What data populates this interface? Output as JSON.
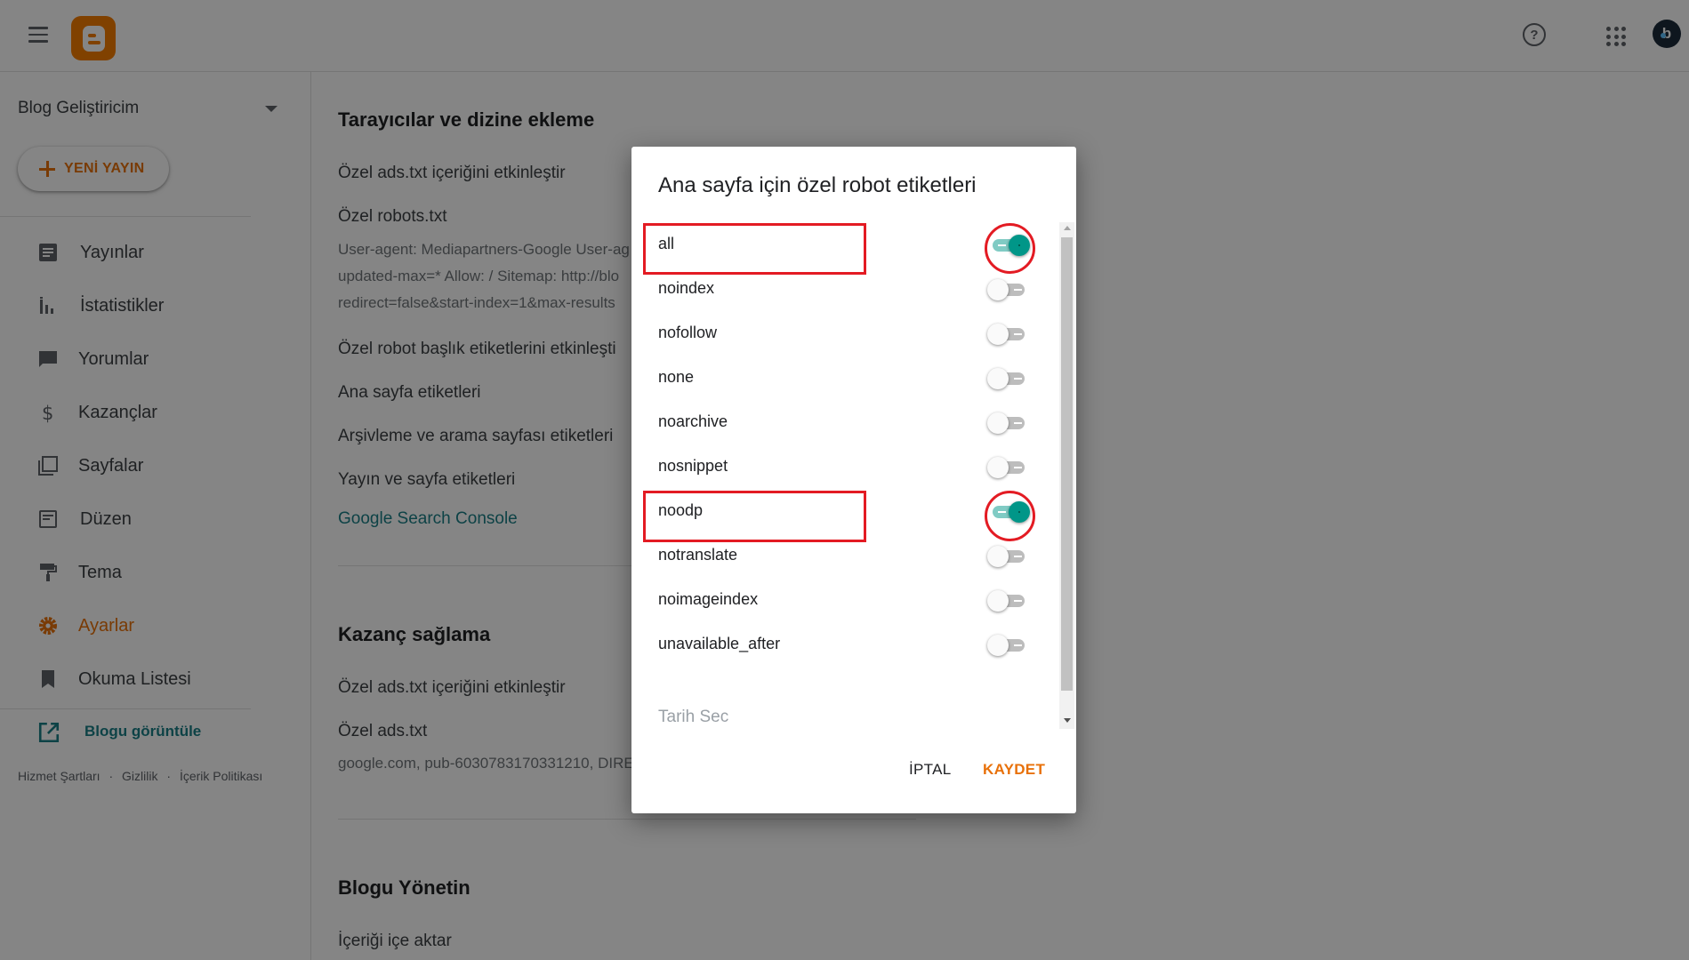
{
  "topbar": {
    "menu_icon": "hamburger-menu-icon",
    "logo_icon": "blogger-logo-icon",
    "help_icon": "help-circle-icon",
    "help_glyph": "?",
    "apps_icon": "apps-grid-icon",
    "avatar_icon": "user-avatar-icon",
    "avatar_letter": "b"
  },
  "sidebar": {
    "blog_name": "Blog Geliştiricim",
    "new_post_label": "YENİ YAYIN",
    "items": [
      {
        "label": "Yayınlar",
        "icon": "posts-icon",
        "active": false
      },
      {
        "label": "İstatistikler",
        "icon": "stats-icon",
        "active": false
      },
      {
        "label": "Yorumlar",
        "icon": "comments-icon",
        "active": false
      },
      {
        "label": "Kazançlar",
        "icon": "earnings-dollar-icon",
        "active": false
      },
      {
        "label": "Sayfalar",
        "icon": "pages-icon",
        "active": false
      },
      {
        "label": "Düzen",
        "icon": "layout-icon",
        "active": false
      },
      {
        "label": "Tema",
        "icon": "theme-paint-roller-icon",
        "active": false
      },
      {
        "label": "Ayarlar",
        "icon": "settings-gear-icon",
        "active": true
      },
      {
        "label": "Okuma Listesi",
        "icon": "bookmark-icon",
        "active": false
      }
    ],
    "view_blog_label": "Blogu görüntüle",
    "footer": {
      "terms": "Hizmet Şartları",
      "privacy": "Gizlilik",
      "content_policy": "İçerik Politikası",
      "separator": "·"
    }
  },
  "main": {
    "section1": {
      "title": "Tarayıcılar ve dizine ekleme",
      "ads_txt_enable": "Özel ads.txt içeriğini etkinleştir",
      "robots_txt_label": "Özel robots.txt",
      "robots_txt_lines": [
        "User-agent: Mediapartners-Google User-ag",
        "updated-max=* Allow: / Sitemap: http://blo",
        "redirect=false&start-index=1&max-results"
      ],
      "robot_header_enable": "Özel robot başlık etiketlerini etkinleşti",
      "home_tags": "Ana sayfa etiketleri",
      "archive_tags": "Arşivleme ve arama sayfası etiketleri",
      "post_tags": "Yayın ve sayfa etiketleri",
      "search_console_link": "Google Search Console"
    },
    "section2": {
      "title": "Kazanç sağlama",
      "ads_txt_enable": "Özel ads.txt içeriğini etkinleştir",
      "ads_txt_label": "Özel ads.txt",
      "ads_txt_value": "google.com, pub-6030783170331210, DIRE"
    },
    "section3": {
      "title": "Blogu Yönetin",
      "import_label": "İçeriği içe aktar"
    }
  },
  "dialog": {
    "title": "Ana sayfa için özel robot etiketleri",
    "options": [
      {
        "label": "all",
        "enabled": true
      },
      {
        "label": "noindex",
        "enabled": false
      },
      {
        "label": "nofollow",
        "enabled": false
      },
      {
        "label": "none",
        "enabled": false
      },
      {
        "label": "noarchive",
        "enabled": false
      },
      {
        "label": "nosnippet",
        "enabled": false
      },
      {
        "label": "noodp",
        "enabled": true
      },
      {
        "label": "notranslate",
        "enabled": false
      },
      {
        "label": "noimageindex",
        "enabled": false
      },
      {
        "label": "unavailable_after",
        "enabled": false
      }
    ],
    "date_placeholder": "Tarih Sec",
    "cancel_label": "İPTAL",
    "save_label": "KAYDET",
    "highlight_color": "#e31b23",
    "toggle_on_color": "#009688"
  }
}
